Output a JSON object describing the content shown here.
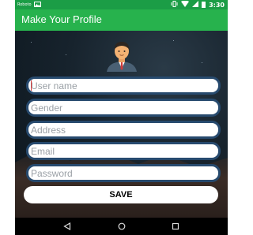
{
  "status_bar": {
    "left_icons": [
      "data-saver-icon",
      "image-icon"
    ],
    "left_text": "Roboto",
    "right_icons": [
      "vibrate-icon",
      "wifi-icon",
      "signal-icon",
      "battery-icon"
    ],
    "time": "3:30",
    "color": "#1b9d46"
  },
  "app_bar": {
    "title": "Make Your Profile",
    "color": "#27b24d"
  },
  "profile": {
    "avatar_icon": "user-avatar-icon"
  },
  "form": {
    "fields": [
      {
        "name": "username",
        "placeholder": "User name",
        "value": ""
      },
      {
        "name": "gender",
        "placeholder": "Gender",
        "value": ""
      },
      {
        "name": "address",
        "placeholder": "Address",
        "value": ""
      },
      {
        "name": "email",
        "placeholder": "Email",
        "value": ""
      },
      {
        "name": "password",
        "placeholder": "Password",
        "value": ""
      }
    ],
    "save_label": "SAVE",
    "field_border_color": "#274a6e"
  },
  "nav_bar": {
    "back_icon": "back-icon",
    "home_icon": "home-icon",
    "recents_icon": "recents-icon"
  }
}
